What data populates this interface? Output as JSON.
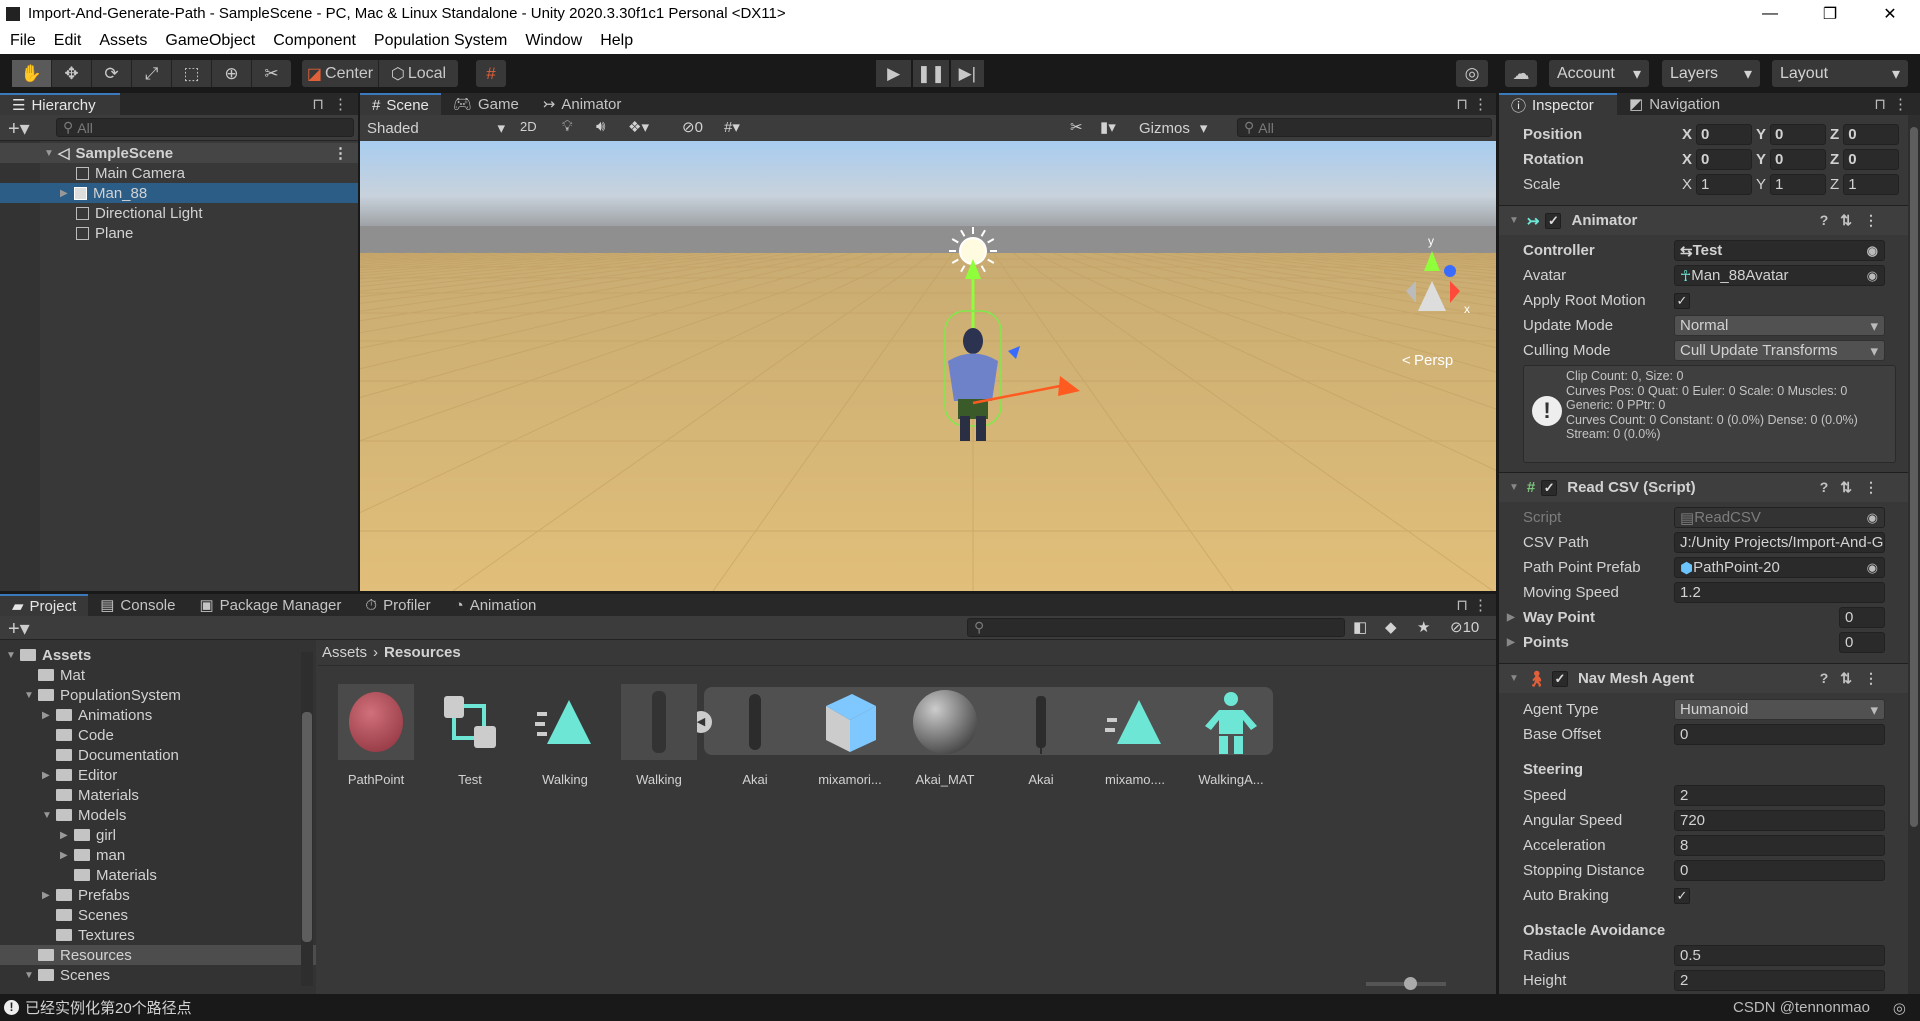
{
  "window": {
    "title": "Import-And-Generate-Path - SampleScene - PC, Mac & Linux Standalone - Unity 2020.3.30f1c1 Personal <DX11>",
    "controls": [
      "—",
      "❐",
      "✕"
    ]
  },
  "menu": [
    "File",
    "Edit",
    "Assets",
    "GameObject",
    "Component",
    "Population System",
    "Window",
    "Help"
  ],
  "toolbar": {
    "pivot": "Center",
    "space": "Local",
    "account": "Account",
    "layers": "Layers",
    "layout": "Layout"
  },
  "hierarchy": {
    "tab": "Hierarchy",
    "search_placeholder": "All",
    "scene": "SampleScene",
    "items": [
      "Main Camera",
      "Man_88",
      "Directional Light",
      "Plane"
    ],
    "selected": "Man_88"
  },
  "scene_view": {
    "tabs": [
      "Scene",
      "Game",
      "Animator"
    ],
    "shading": "Shaded",
    "mode_2d": "2D",
    "hidden_count": "0",
    "gizmos": "Gizmos",
    "search_placeholder": "All",
    "projection": "Persp",
    "axis_y": "y",
    "axis_x": "x"
  },
  "inspector": {
    "tabs": [
      "Inspector",
      "Navigation"
    ],
    "transform": {
      "position": {
        "label": "Position",
        "x": "0",
        "y": "0",
        "z": "0"
      },
      "rotation": {
        "label": "Rotation",
        "x": "0",
        "y": "0",
        "z": "0"
      },
      "scale": {
        "label": "Scale",
        "x": "1",
        "y": "1",
        "z": "1"
      }
    },
    "animator": {
      "title": "Animator",
      "controller_label": "Controller",
      "controller": "Test",
      "avatar_label": "Avatar",
      "avatar": "Man_88Avatar",
      "apply_root_motion_label": "Apply Root Motion",
      "update_mode_label": "Update Mode",
      "update_mode": "Normal",
      "culling_mode_label": "Culling Mode",
      "culling_mode": "Cull Update Transforms",
      "info": [
        "Clip Count: 0, Size: 0",
        "Curves Pos: 0 Quat: 0 Euler: 0 Scale: 0 Muscles: 0",
        "Generic: 0 PPtr: 0",
        "Curves Count: 0 Constant: 0 (0.0%) Dense: 0 (0.0%)",
        "Stream: 0 (0.0%)"
      ]
    },
    "read_csv": {
      "title": "Read CSV (Script)",
      "script_label": "Script",
      "script": "ReadCSV",
      "csv_path_label": "CSV Path",
      "csv_path": "J:/Unity Projects/Import-And-Generate-Path",
      "prefab_label": "Path Point Prefab",
      "prefab": "PathPoint-20",
      "moving_speed_label": "Moving Speed",
      "moving_speed": "1.2",
      "way_point_label": "Way Point",
      "way_point": "0",
      "points_label": "Points",
      "points": "0"
    },
    "nav_mesh_agent": {
      "title": "Nav Mesh Agent",
      "agent_type_label": "Agent Type",
      "agent_type": "Humanoid",
      "base_offset_label": "Base Offset",
      "base_offset": "0",
      "steering": "Steering",
      "speed_label": "Speed",
      "speed": "2",
      "angular_speed_label": "Angular Speed",
      "angular_speed": "720",
      "acceleration_label": "Acceleration",
      "acceleration": "8",
      "stopping_distance_label": "Stopping Distance",
      "stopping_distance": "0",
      "auto_braking_label": "Auto Braking",
      "obstacle_avoidance": "Obstacle Avoidance",
      "radius_label": "Radius",
      "radius": "0.5",
      "height_label": "Height",
      "height": "2"
    }
  },
  "project": {
    "tabs": [
      "Project",
      "Console",
      "Package Manager",
      "Profiler",
      "Animation"
    ],
    "hidden_count": "10",
    "breadcrumb": [
      "Assets",
      "Resources"
    ],
    "tree": [
      {
        "label": "Assets",
        "depth": 0,
        "arrow": "open",
        "bold": true
      },
      {
        "label": "Mat",
        "depth": 1,
        "arrow": ""
      },
      {
        "label": "PopulationSystem",
        "depth": 1,
        "arrow": "open"
      },
      {
        "label": "Animations",
        "depth": 2,
        "arrow": "closed"
      },
      {
        "label": "Code",
        "depth": 2,
        "arrow": ""
      },
      {
        "label": "Documentation",
        "depth": 2,
        "arrow": ""
      },
      {
        "label": "Editor",
        "depth": 2,
        "arrow": "closed"
      },
      {
        "label": "Materials",
        "depth": 2,
        "arrow": ""
      },
      {
        "label": "Models",
        "depth": 2,
        "arrow": "open"
      },
      {
        "label": "girl",
        "depth": 3,
        "arrow": "closed"
      },
      {
        "label": "man",
        "depth": 3,
        "arrow": "closed"
      },
      {
        "label": "Materials",
        "depth": 3,
        "arrow": ""
      },
      {
        "label": "Prefabs",
        "depth": 2,
        "arrow": "closed"
      },
      {
        "label": "Scenes",
        "depth": 2,
        "arrow": ""
      },
      {
        "label": "Textures",
        "depth": 2,
        "arrow": ""
      },
      {
        "label": "Resources",
        "depth": 1,
        "arrow": "",
        "selected": true
      },
      {
        "label": "Scenes",
        "depth": 1,
        "arrow": "open"
      }
    ],
    "assets": [
      "PathPoint",
      "Test",
      "Walking",
      "Walking",
      "Akai",
      "mixamori...",
      "Akai_MAT",
      "Akai",
      "mixamo....",
      "WalkingA..."
    ]
  },
  "status": {
    "message": "已经实例化第20个路径点",
    "watermark": "CSDN @tennonmao"
  },
  "colors": {
    "selection": "#2c5d87",
    "accent_teal": "#6ee6d6",
    "ground": "#d8b56f",
    "panel": "#383838"
  }
}
